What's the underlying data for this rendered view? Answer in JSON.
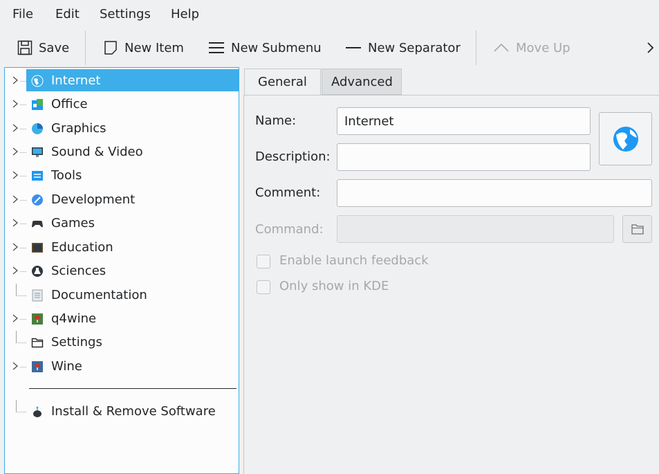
{
  "menubar": {
    "file": "File",
    "edit": "Edit",
    "settings": "Settings",
    "help": "Help"
  },
  "toolbar": {
    "save": "Save",
    "new_item": "New Item",
    "new_submenu": "New Submenu",
    "new_separator": "New Separator",
    "move_up": "Move Up",
    "overflow_icon": "chevron-right-icon"
  },
  "tree": {
    "items": [
      {
        "label": "Internet",
        "icon": "globe-icon",
        "expandable": true,
        "selected": true
      },
      {
        "label": "Office",
        "icon": "office-icon",
        "expandable": true
      },
      {
        "label": "Graphics",
        "icon": "graphics-icon",
        "expandable": true
      },
      {
        "label": "Sound & Video",
        "icon": "monitor-icon",
        "expandable": true
      },
      {
        "label": "Tools",
        "icon": "tools-icon",
        "expandable": true
      },
      {
        "label": "Development",
        "icon": "development-icon",
        "expandable": true
      },
      {
        "label": "Games",
        "icon": "gamepad-icon",
        "expandable": true
      },
      {
        "label": "Education",
        "icon": "chalkboard-icon",
        "expandable": true
      },
      {
        "label": "Sciences",
        "icon": "flask-icon",
        "expandable": true
      },
      {
        "label": "Documentation",
        "icon": "document-icon",
        "expandable": false
      },
      {
        "label": "q4wine",
        "icon": "wine-glass-icon",
        "expandable": true
      },
      {
        "label": "Settings",
        "icon": "settings-folder-icon",
        "expandable": false
      },
      {
        "label": "Wine",
        "icon": "wine-icon",
        "expandable": true
      }
    ],
    "footer_item": {
      "label": "Install & Remove Software",
      "icon": "software-bag-icon"
    }
  },
  "tabs": {
    "general": "General",
    "advanced": "Advanced"
  },
  "form": {
    "name_label": "Name:",
    "name_value": "Internet",
    "description_label": "Description:",
    "description_value": "",
    "comment_label": "Comment:",
    "comment_value": "",
    "command_label": "Command:",
    "command_value": "",
    "launch_feedback": "Enable launch feedback",
    "only_kde": "Only show in KDE"
  },
  "colors": {
    "accent": "#3daee9",
    "window_bg": "#eff0f1",
    "text": "#232629",
    "disabled": "#a6a8ab"
  }
}
